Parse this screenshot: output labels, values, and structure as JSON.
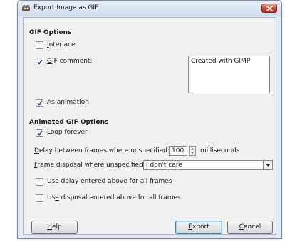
{
  "window": {
    "title": "Export Image as GIF"
  },
  "gif_options": {
    "heading": "GIF Options",
    "interlace": {
      "label_mnemonic": "I",
      "label_rest": "nterlace",
      "checked": false
    },
    "gif_comment": {
      "label_mnemonic": "G",
      "label_rest": "IF comment:",
      "checked": true
    },
    "comment_value": "Created with GIMP",
    "as_animation": {
      "label_pre": "As ",
      "label_mnemonic": "a",
      "label_rest": "nimation",
      "checked": true
    }
  },
  "animated_options": {
    "heading": "Animated GIF Options",
    "loop_forever": {
      "label_mnemonic": "L",
      "label_rest": "oop forever",
      "checked": true
    },
    "delay_label_mnemonic": "D",
    "delay_label_rest": "elay between frames where unspecified:",
    "delay_value": "100",
    "delay_unit": "milliseconds",
    "disposal_label_mnemonic": "F",
    "disposal_label_rest": "rame disposal where unspecified:",
    "disposal_value": "I don't care",
    "use_delay": {
      "label_mnemonic": "U",
      "label_rest": "se delay entered above for all frames",
      "checked": false
    },
    "use_disposal": {
      "label_pre": "Us",
      "label_mnemonic": "e",
      "label_rest": " disposal entered above for all frames",
      "checked": false
    }
  },
  "buttons": {
    "help_mnemonic": "H",
    "help_rest": "elp",
    "export_mnemonic": "E",
    "export_rest": "xport",
    "cancel_mnemonic": "C",
    "cancel_rest": "ancel"
  },
  "icons": {
    "app": "gimp-wilber-icon",
    "close": "close-icon",
    "check": "checkmark-icon",
    "spin": "spin-arrows-icon",
    "dropdown": "chevron-down-icon"
  },
  "colors": {
    "close_button": "#c8442c",
    "client_bg": "#f0f0f0",
    "frame_bg": "#dfe9f5"
  }
}
